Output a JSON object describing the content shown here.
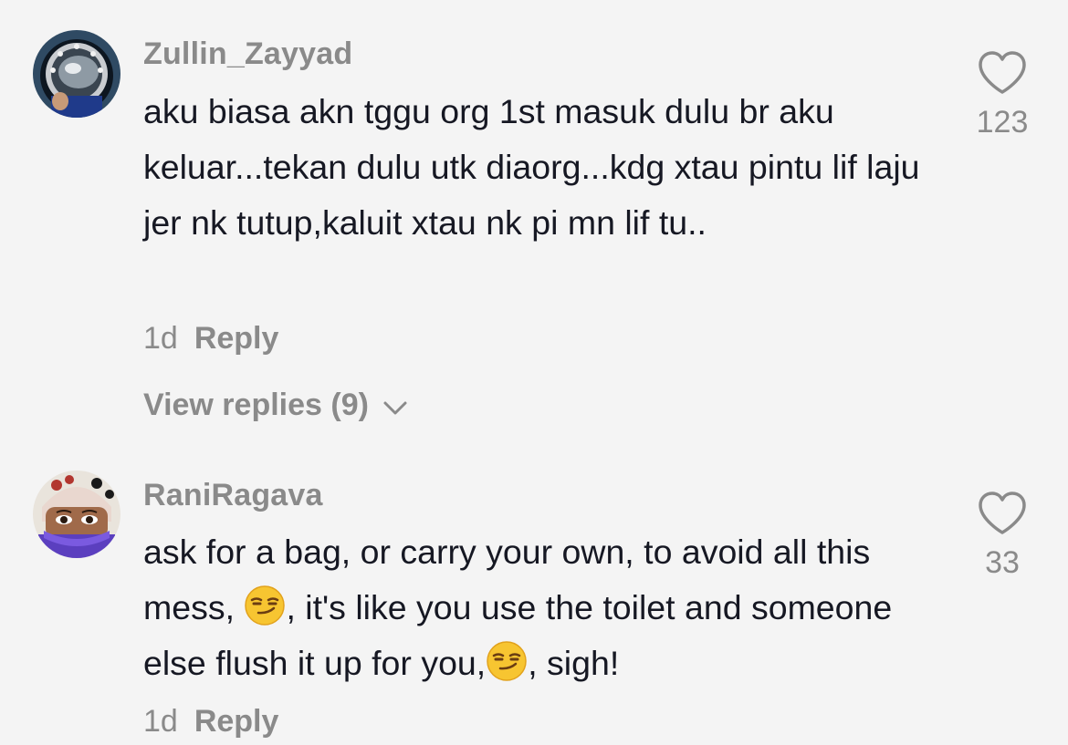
{
  "comments": [
    {
      "username": "Zullin_Zayyad",
      "text": "aku biasa akn tggu org 1st masuk dulu br aku keluar...tekan dulu utk diaorg...kdg xtau pintu lif laju jer nk tutup,kaluit xtau nk pi mn lif tu..",
      "time": "1d",
      "reply_label": "Reply",
      "view_replies_label": "View replies (9)",
      "likes": "123",
      "avatar": "astronaut-helmet-avatar"
    },
    {
      "username": "RaniRagava",
      "text_part1": "ask for a bag, or carry your own, to avoid all this mess, ",
      "text_part2": ", it's like you use the toilet and someone else flush it up for you,",
      "text_part3": ", sigh!",
      "emoji": "smirking-face",
      "time": "1d",
      "reply_label": "Reply",
      "likes": "33",
      "avatar": "woman-with-bandana-avatar"
    }
  ],
  "colors": {
    "background": "#f4f4f4",
    "text": "#161823",
    "secondary": "#8a8a8a"
  }
}
